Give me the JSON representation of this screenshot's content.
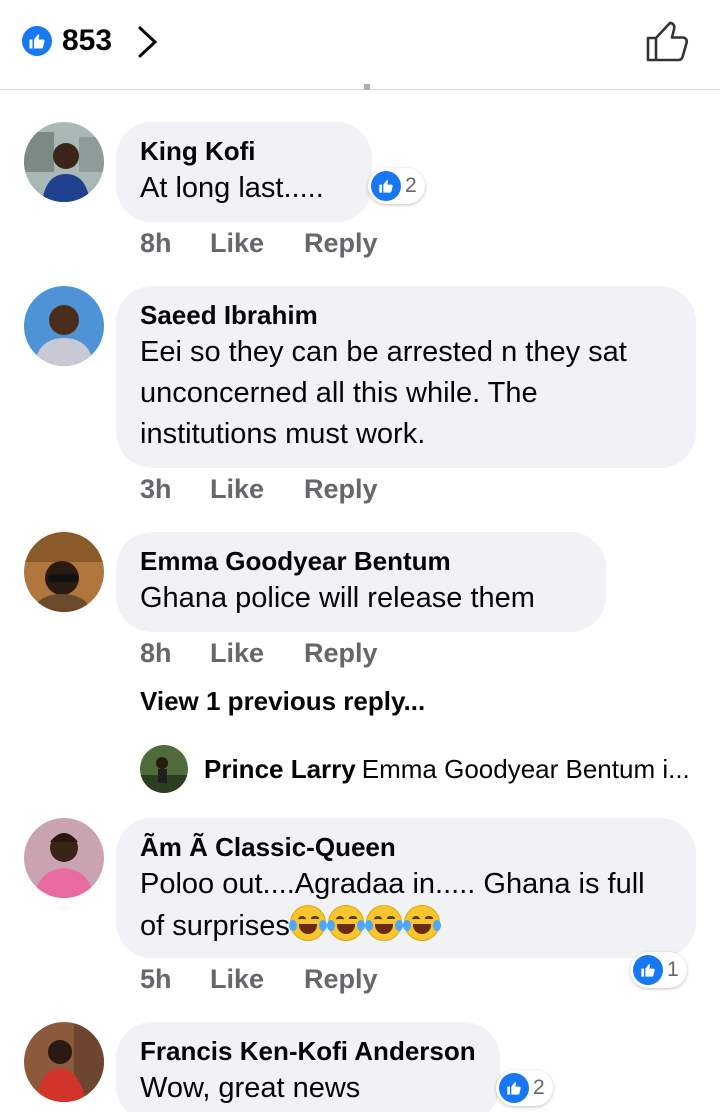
{
  "header": {
    "like_count": "853",
    "icons": [
      "like-icon",
      "chevron-right-icon",
      "thumbs-up-outline-icon"
    ]
  },
  "comments": [
    {
      "name": "King Kofi",
      "text": "At long last.....",
      "time": "8h",
      "like_label": "Like",
      "reply_label": "Reply",
      "reactions": "2"
    },
    {
      "name": "Saeed Ibrahim",
      "text": "Eei so they can be arrested n they sat unconcerned all this while. The institutions must work.",
      "time": "3h",
      "like_label": "Like",
      "reply_label": "Reply"
    },
    {
      "name": "Emma Goodyear Bentum",
      "text": "Ghana police will release them",
      "time": "8h",
      "like_label": "Like",
      "reply_label": "Reply",
      "view_previous": "View 1 previous reply...",
      "reply_preview": {
        "name": "Prince Larry",
        "text": "Emma Goodyear Bentum  i..."
      }
    },
    {
      "name": "Ãm Ã Classic-Queen",
      "text": "Poloo out....Agradaa in..... Ghana is full of surprises",
      "emoji": "😂😂😂😂",
      "time": "5h",
      "like_label": "Like",
      "reply_label": "Reply",
      "reactions": "1"
    },
    {
      "name": "Francis Ken-Kofi Anderson",
      "text": "Wow, great news",
      "reactions": "2"
    }
  ],
  "colors": {
    "accent": "#1877f2",
    "bubble": "#f0f2f5",
    "meta": "#65676b"
  }
}
